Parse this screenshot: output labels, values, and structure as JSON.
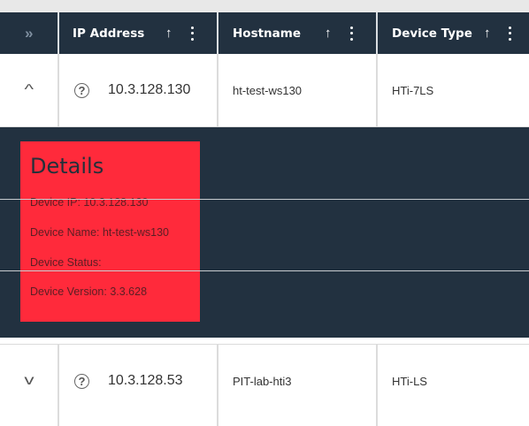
{
  "table": {
    "columns": [
      {
        "label": "IP Address",
        "sort_icon": "arrow-up-icon",
        "menu_icon": "vertical-dots-icon"
      },
      {
        "label": "Hostname",
        "sort_icon": "arrow-up-icon",
        "menu_icon": "vertical-dots-icon"
      },
      {
        "label": "Device Type",
        "sort_icon": "arrow-up-icon",
        "menu_icon": "vertical-dots-icon"
      }
    ],
    "expand_all_icon": "»",
    "sort_glyph": "↑",
    "rows": [
      {
        "expanded": true,
        "expand_glyph": "^",
        "status_icon": "?",
        "ip": "10.3.128.130",
        "hostname": "ht-test-ws130",
        "device_type": "HTi-7LS"
      },
      {
        "expanded": false,
        "expand_glyph": "v",
        "status_icon": "?",
        "ip": "10.3.128.53",
        "hostname": "PIT-lab-hti3",
        "device_type": "HTi-LS"
      }
    ]
  },
  "details": {
    "title": "Details",
    "lines": [
      "Device IP: 10.3.128.130",
      "Device Name: ht-test-ws130",
      "Device Status:",
      "Device Version: 3.3.628"
    ]
  },
  "colors": {
    "header_bg": "#223140",
    "details_bg": "#ff2a3b",
    "row_bg": "#ffffff"
  }
}
